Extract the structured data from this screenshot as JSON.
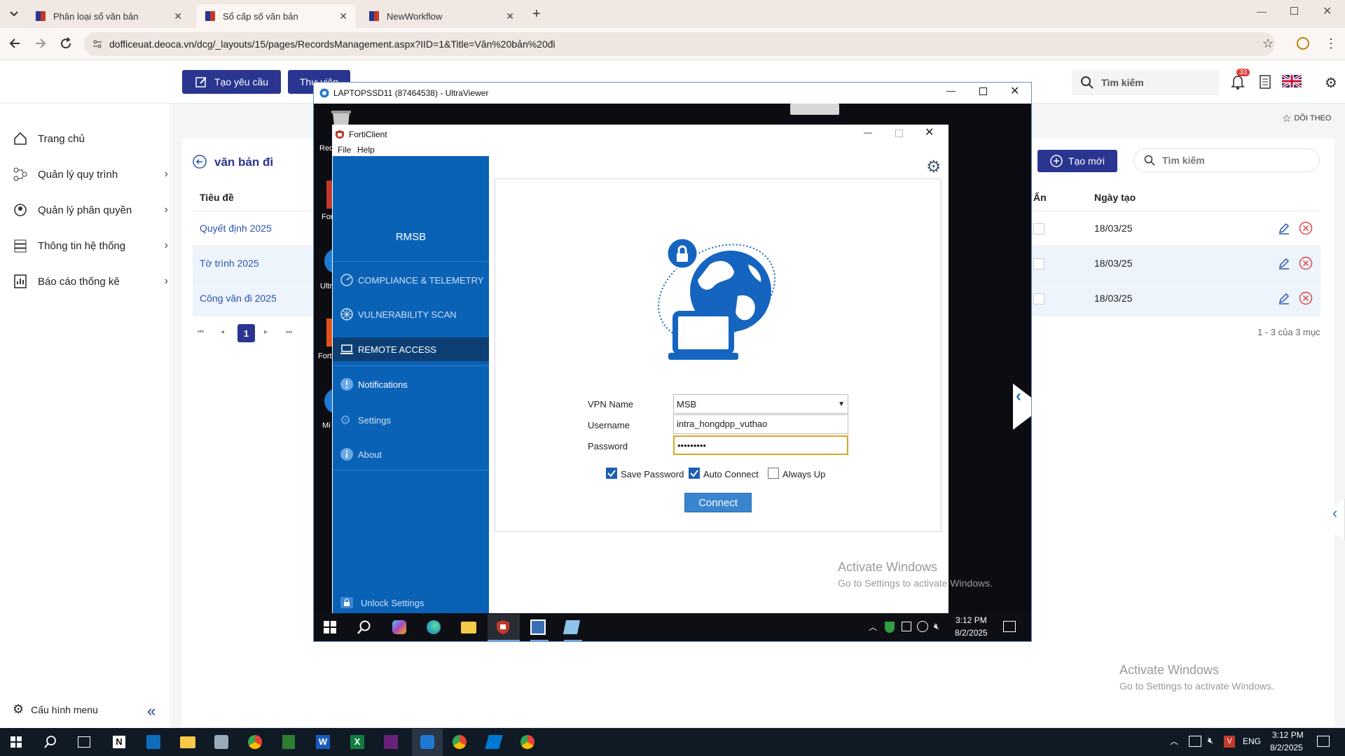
{
  "browser": {
    "tabs": [
      {
        "label": "Phân loại sổ văn bản"
      },
      {
        "label": "Sổ cấp số văn bản"
      },
      {
        "label": "NewWorkflow"
      }
    ],
    "url": "dofficeuat.deoca.vn/dcg/_layouts/15/pages/RecordsManagement.aspx?IID=1&Title=Văn%20bản%20đi"
  },
  "header": {
    "create_request_label": "Tạo yêu cầu",
    "library_label": "Thư viện",
    "search_placeholder": "Tìm kiếm",
    "notification_count": "33"
  },
  "sidebar": {
    "items": [
      {
        "label": "Trang chủ"
      },
      {
        "label": "Quản lý quy trình"
      },
      {
        "label": "Quản lý phân quyền"
      },
      {
        "label": "Thông tin hệ thống"
      },
      {
        "label": "Báo cáo thống kê"
      }
    ],
    "config_label": "Cấu hình menu"
  },
  "main": {
    "follow_label": "DÕI THEO",
    "page_title": "văn bản đi",
    "new_button_label": "Tạo mới",
    "search_placeholder": "Tìm kiếm",
    "columns": {
      "title": "Tiêu đề",
      "hidden": "Ẩn",
      "created": "Ngày tạo"
    },
    "rows": [
      {
        "title": "Quyết định 2025",
        "created": "18/03/25"
      },
      {
        "title": "Tờ trình 2025",
        "created": "18/03/25"
      },
      {
        "title": "Công văn đi 2025",
        "created": "18/03/25"
      }
    ],
    "current_page": "1",
    "pagination_summary": "1 - 3 của 3 mục"
  },
  "ultraviewer": {
    "title": "LAPTOPSSD11 (87464538) - UltraViewer"
  },
  "desktop_icons": [
    "Rec",
    "Forti",
    "Ultr",
    "Forti",
    "Mi"
  ],
  "forticlient": {
    "title": "FortiClient",
    "menu": [
      "File",
      "Help"
    ],
    "brand": "RMSB",
    "nav": [
      {
        "label": "COMPLIANCE & TELEMETRY"
      },
      {
        "label": "VULNERABILITY SCAN"
      },
      {
        "label": "REMOTE ACCESS"
      },
      {
        "label": "Notifications"
      },
      {
        "label": "Settings"
      },
      {
        "label": "About"
      }
    ],
    "unlock_label": "Unlock Settings",
    "form": {
      "vpn_name_label": "VPN Name",
      "vpn_name_value": "MSB",
      "username_label": "Username",
      "username_value": "intra_hongdpp_vuthao",
      "password_label": "Password",
      "password_value": "•••••••••",
      "save_password_label": "Save Password",
      "auto_connect_label": "Auto Connect",
      "always_up_label": "Always Up",
      "connect_label": "Connect",
      "save_password_checked": true,
      "auto_connect_checked": true,
      "always_up_checked": false
    }
  },
  "remote_taskbar": {
    "time": "3:12 PM",
    "date": "8/2/2025"
  },
  "watermark": {
    "line1": "Activate Windows",
    "line2": "Go to Settings to activate Windows."
  },
  "local_taskbar": {
    "lang": "ENG",
    "time": "3:12 PM",
    "date": "8/2/2025"
  },
  "colors": {
    "brand_navy": "#2a3590",
    "forti_blue": "#0a62b7",
    "forti_active": "#0d3f74",
    "connect_blue": "#3a85d0"
  }
}
